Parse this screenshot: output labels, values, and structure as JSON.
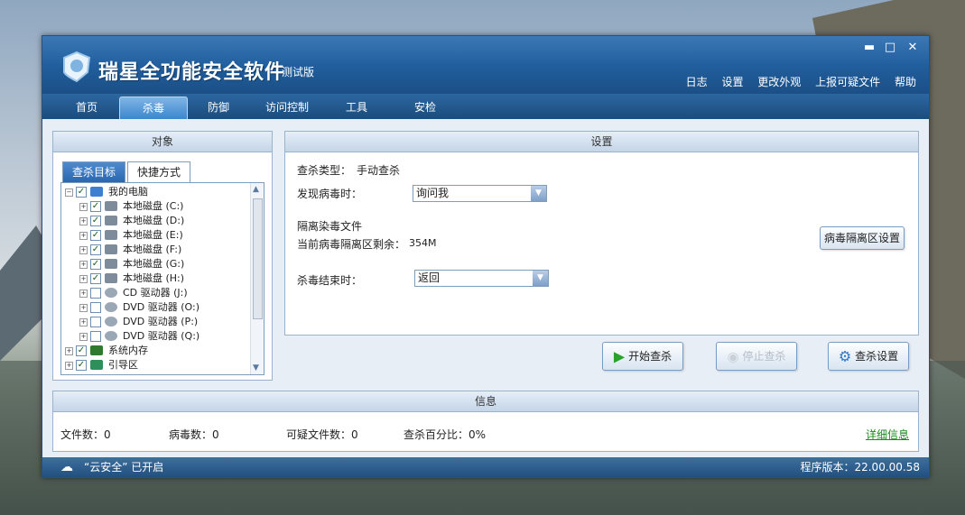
{
  "app": {
    "title": "瑞星全功能安全软件",
    "edition": "测试版",
    "window_controls": {
      "minimize": "▬",
      "maximize": "□",
      "close": "✕"
    },
    "top_links": [
      "日志",
      "设置",
      "更改外观",
      "上报可疑文件",
      "帮助"
    ]
  },
  "tabs": [
    {
      "label": "首页",
      "active": false
    },
    {
      "label": "杀毒",
      "active": true
    },
    {
      "label": "防御",
      "active": false
    },
    {
      "label": "访问控制",
      "active": false
    },
    {
      "label": "工具",
      "active": false
    },
    {
      "label": "安检",
      "active": false
    }
  ],
  "target_panel": {
    "title": "对象",
    "subtabs": [
      "查杀目标",
      "快捷方式"
    ],
    "tree": [
      {
        "label": "我的电脑",
        "checked": true,
        "icon": "computer-icon",
        "level": 0
      },
      {
        "label": "本地磁盘 (C:)",
        "checked": true,
        "icon": "disk-icon",
        "level": 1
      },
      {
        "label": "本地磁盘 (D:)",
        "checked": true,
        "icon": "disk-icon",
        "level": 1
      },
      {
        "label": "本地磁盘 (E:)",
        "checked": true,
        "icon": "disk-icon",
        "level": 1
      },
      {
        "label": "本地磁盘 (F:)",
        "checked": true,
        "icon": "disk-icon",
        "level": 1
      },
      {
        "label": "本地磁盘 (G:)",
        "checked": true,
        "icon": "disk-icon",
        "level": 1
      },
      {
        "label": "本地磁盘 (H:)",
        "checked": true,
        "icon": "disk-icon",
        "level": 1
      },
      {
        "label": "CD 驱动器 (J:)",
        "checked": false,
        "icon": "cd-drive-icon",
        "level": 1
      },
      {
        "label": "DVD 驱动器 (O:)",
        "checked": false,
        "icon": "dvd-drive-icon",
        "level": 1
      },
      {
        "label": "DVD 驱动器 (P:)",
        "checked": false,
        "icon": "dvd-drive-icon",
        "level": 1
      },
      {
        "label": "DVD 驱动器 (Q:)",
        "checked": false,
        "icon": "dvd-drive-icon",
        "level": 1
      },
      {
        "label": "系统内存",
        "checked": true,
        "icon": "memory-icon",
        "level": 0
      },
      {
        "label": "引导区",
        "checked": true,
        "icon": "boot-sector-icon",
        "level": 0
      }
    ]
  },
  "settings_panel": {
    "title": "设置",
    "scan_type_label": "查杀类型：",
    "scan_type_value": "手动查杀",
    "on_virus_label": "发现病毒时：",
    "on_virus_value": "询问我",
    "quarantine_title": "隔离染毒文件",
    "quarantine_remaining_label": "当前病毒隔离区剩余：",
    "quarantine_remaining_value": "354M",
    "quarantine_button": "病毒隔离区设置",
    "on_finish_label": "杀毒结束时：",
    "on_finish_value": "返回"
  },
  "actions": {
    "start": "开始查杀",
    "stop": "停止查杀",
    "settings": "查杀设置"
  },
  "info_panel": {
    "title": "信息",
    "files_label": "文件数：",
    "files_value": "0",
    "virus_label": "病毒数：",
    "virus_value": "0",
    "suspicious_label": "可疑文件数：",
    "suspicious_value": "0",
    "percent_label": "查杀百分比：",
    "percent_value": "0%",
    "details_link": "详细信息"
  },
  "status_bar": {
    "cloud": "“云安全” 已开启",
    "version_label": "程序版本：",
    "version_value": "22.00.00.58"
  },
  "colors": {
    "accent": "#215f9e",
    "link": "#1a8a1a"
  }
}
